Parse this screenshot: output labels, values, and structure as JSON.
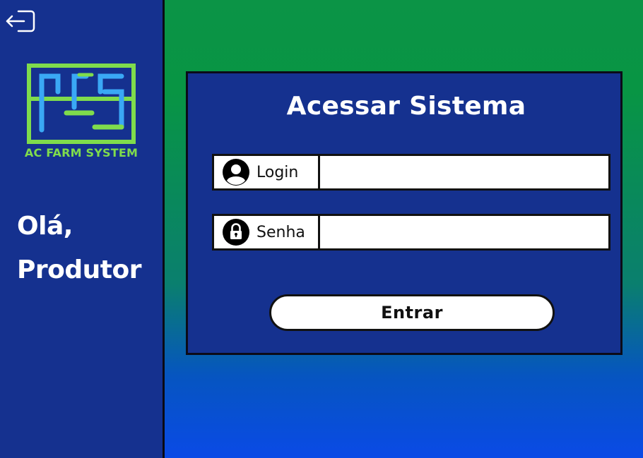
{
  "sidebar": {
    "brand": "AC FARM SYSTEM",
    "greeting_line1": "Olá,",
    "greeting_line2": "Produtor",
    "logout_icon": "logout-icon"
  },
  "login_panel": {
    "title": "Acessar Sistema",
    "login_label": "Login",
    "login_icon": "user-icon",
    "login_value": "",
    "password_label": "Senha",
    "password_icon": "lock-icon",
    "password_value": "",
    "submit_label": "Entrar"
  },
  "colors": {
    "sidebar_bg": "#15318f",
    "panel_bg": "#15318f",
    "brand_green": "#7fdc4c",
    "logo_blue": "#3aa8f5",
    "gradient_top": "#0b9446",
    "gradient_bottom": "#0a4ae6"
  }
}
